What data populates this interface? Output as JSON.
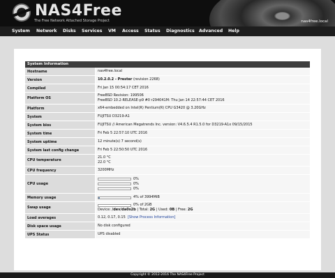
{
  "header": {
    "logo_text": "NAS4Free",
    "tagline": "The Free Network Attached Storage Project",
    "hostname": "nas4free.local"
  },
  "menu": [
    "System",
    "Network",
    "Disks",
    "Services",
    "VM",
    "Access",
    "Status",
    "Diagnostics",
    "Advanced",
    "Help"
  ],
  "system_info": {
    "title": "System Information",
    "hostname_label": "Hostname",
    "hostname": "nas4free.local",
    "version_label": "Version",
    "version_name": "10.2.0.2 - Prester",
    "version_revision": "(revision 2268)",
    "compiled_label": "Compiled",
    "compiled": "Fri Jan 15 00:54:17 CET 2016",
    "platform_os_label": "Platform OS",
    "platform_os_line1": "FreeBSD Revision: 199506",
    "platform_os_line2": "FreeBSD 10.2-RELEASE-p9 #0 r294041M: Thu Jan 14 22:57:44 CET 2016",
    "platform_label": "Platform",
    "platform": "x64-embedded on Intel(R) Pentium(R) CPU G3420 @ 3.20GHz",
    "system_label": "System",
    "system": "FUJITSU D3219-A1",
    "bios_label": "System bios",
    "bios": "FUJITSU // American Megatrends Inc. version: V4.6.5.4 R1.5.0 for D3219-A1x 09/15/2015",
    "time_label": "System time",
    "time": "Fri Feb 5 22:57:10 UTC 2016",
    "uptime_label": "System uptime",
    "uptime": "12 minute(s) 7 second(s)",
    "last_config_label": "System last config change",
    "last_config": "Fri Feb 5 22:50:50 UTC 2016",
    "cpu_temp_label": "CPU temperature",
    "cpu_temp_1": "21.0 °C",
    "cpu_temp_2": "22.0 °C",
    "cpu_freq_label": "CPU frequency",
    "cpu_freq": "3200MHz",
    "cpu_usage_label": "CPU usage",
    "cpu_usage": [
      {
        "percent": 0,
        "text": "0%"
      },
      {
        "percent": 0,
        "text": "0%"
      },
      {
        "percent": 0,
        "text": "0%"
      }
    ],
    "memory_label": "Memory usage",
    "memory_percent": 4,
    "memory_text": "4% of 3994MiB",
    "swap_label": "Swap usage",
    "swap_percent": 0,
    "swap_text": "0% of 2GB",
    "swap_device_prefix": "Device:",
    "swap_device": "/dev/da0s2b",
    "swap_sep1": "| Total:",
    "swap_total": "2G",
    "swap_sep2": "| Used:",
    "swap_used": "0B",
    "swap_sep3": "| Free:",
    "swap_free": "2G",
    "load_label": "Load averages",
    "load": "0.12, 0.17, 0.15",
    "load_link": "[Show Process Information]",
    "disk_label": "Disk space usage",
    "disk": "No disk configured",
    "ups_label": "UPS Status",
    "ups": "UPS disabled"
  },
  "footer": {
    "copyright": "Copyright © 2012-2016 The NAS4Free Project"
  },
  "colors": {
    "bar_fill": "#6c8fb6",
    "header_bg": "#0e0e0e",
    "section_header": "#3d3d3d"
  }
}
